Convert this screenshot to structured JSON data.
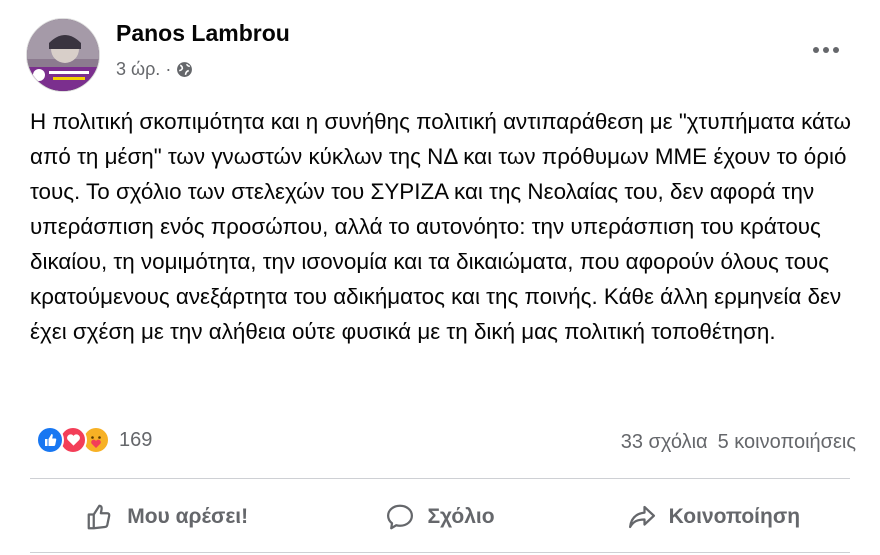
{
  "post": {
    "author": "Panos Lambrou",
    "time": "3 ώρ.",
    "separator": "·",
    "privacy_icon": "globe-icon",
    "text": "Η πολιτική σκοπιμότητα και η συνήθης πολιτική αντιπαράθεση με \"χτυπήματα κάτω από τη μέση\" των γνωστών κύκλων της ΝΔ και των πρόθυμων ΜΜΕ έχουν το όριό τους. Το σχόλιο των στελεχών του ΣΥΡΙΖΑ και της Νεολαίας του, δεν αφορά την υπεράσπιση ενός προσώπου, αλλά το αυτονόητο: την υπεράσπιση του κράτους δικαίου, τη νομιμότητα, την ισονομία και τα δικαιώματα, που αφορούν όλους τους κρατούμενους ανεξάρτητα του αδικήματος και της ποινής. Κάθε άλλη ερμηνεία δεν έχει σχέση με την αλήθεια ούτε φυσικά με τη δική μας πολιτική τοποθέτηση."
  },
  "engagement": {
    "reaction_count": "169",
    "comments": "33 σχόλια",
    "shares": "5 κοινοποιήσεις",
    "reactions": [
      "like",
      "love",
      "care"
    ]
  },
  "actions": {
    "like": "Μου αρέσει!",
    "comment": "Σχόλιο",
    "share": "Κοινοποίηση"
  },
  "colors": {
    "like_blue": "#1877f2",
    "love_red": "#f33e58",
    "care_yellow": "#f7b125",
    "secondary_text": "#65676b"
  }
}
